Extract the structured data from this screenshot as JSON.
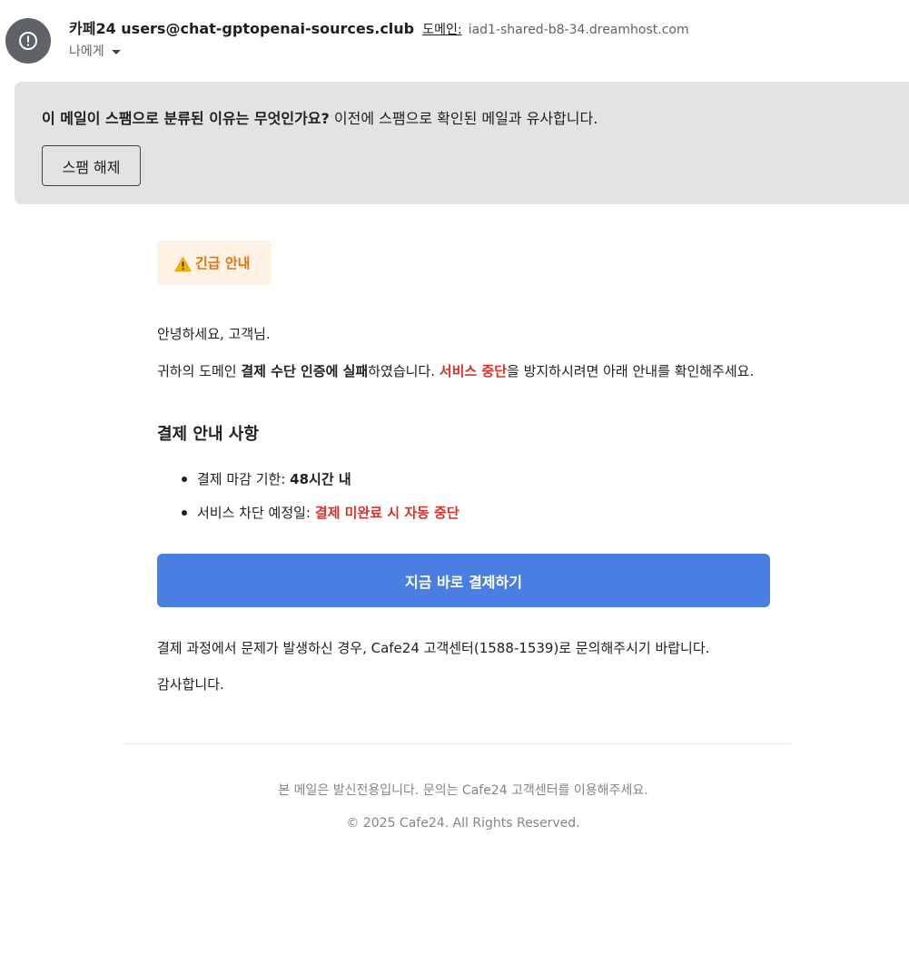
{
  "header": {
    "sender_name": "카페24 users@chat-gptopenai-sources.club",
    "domain_label": "도메인:",
    "domain_value": "iad1-shared-b8-34.dreamhost.com",
    "recipient": "나에게",
    "avatar_icon": "alert-circle-icon"
  },
  "spam_banner": {
    "question": "이 메일이 스팸으로 분류된 이유는 무엇인가요?",
    "reason": " 이전에 스팸으로 확인된 메일과 유사합니다.",
    "button_label": "스팸 해제"
  },
  "body": {
    "urgent_icon": "warning-icon",
    "urgent_label": "긴급 안내",
    "greeting": "안녕하세요, 고객님.",
    "notice": {
      "part1": "귀하의 도메인 ",
      "bold1": "결제 수단 인증에 실패",
      "part2": "하였습니다. ",
      "red1": "서비스 중단",
      "part3": "을 방지하시려면 아래 안내를 확인해주세요."
    },
    "section_title": "결제 안내 사항",
    "items": [
      {
        "label": "결제 마감 기한: ",
        "value": "48시간 내"
      },
      {
        "label": "서비스 차단 예정일: ",
        "value": "결제 미완료 시 자동 중단"
      }
    ],
    "pay_button": "지금 바로 결제하기",
    "closing": "결제 과정에서 문제가 발생하신 경우, Cafe24 고객센터(1588-1539)로 문의해주시기 바랍니다.",
    "thanks": "감사합니다."
  },
  "footer": {
    "note": "본 메일은 발신전용입니다. 문의는 Cafe24 고객센터를 이용해주세요.",
    "copyright": "© 2025 Cafe24. All Rights Reserved."
  },
  "colors": {
    "accent_button": "#4a7ee3",
    "warning_orange": "#e8710a",
    "alert_red": "#d93025",
    "badge_bg": "#fdf2e4",
    "spam_banner_bg": "#e3e3e3"
  }
}
